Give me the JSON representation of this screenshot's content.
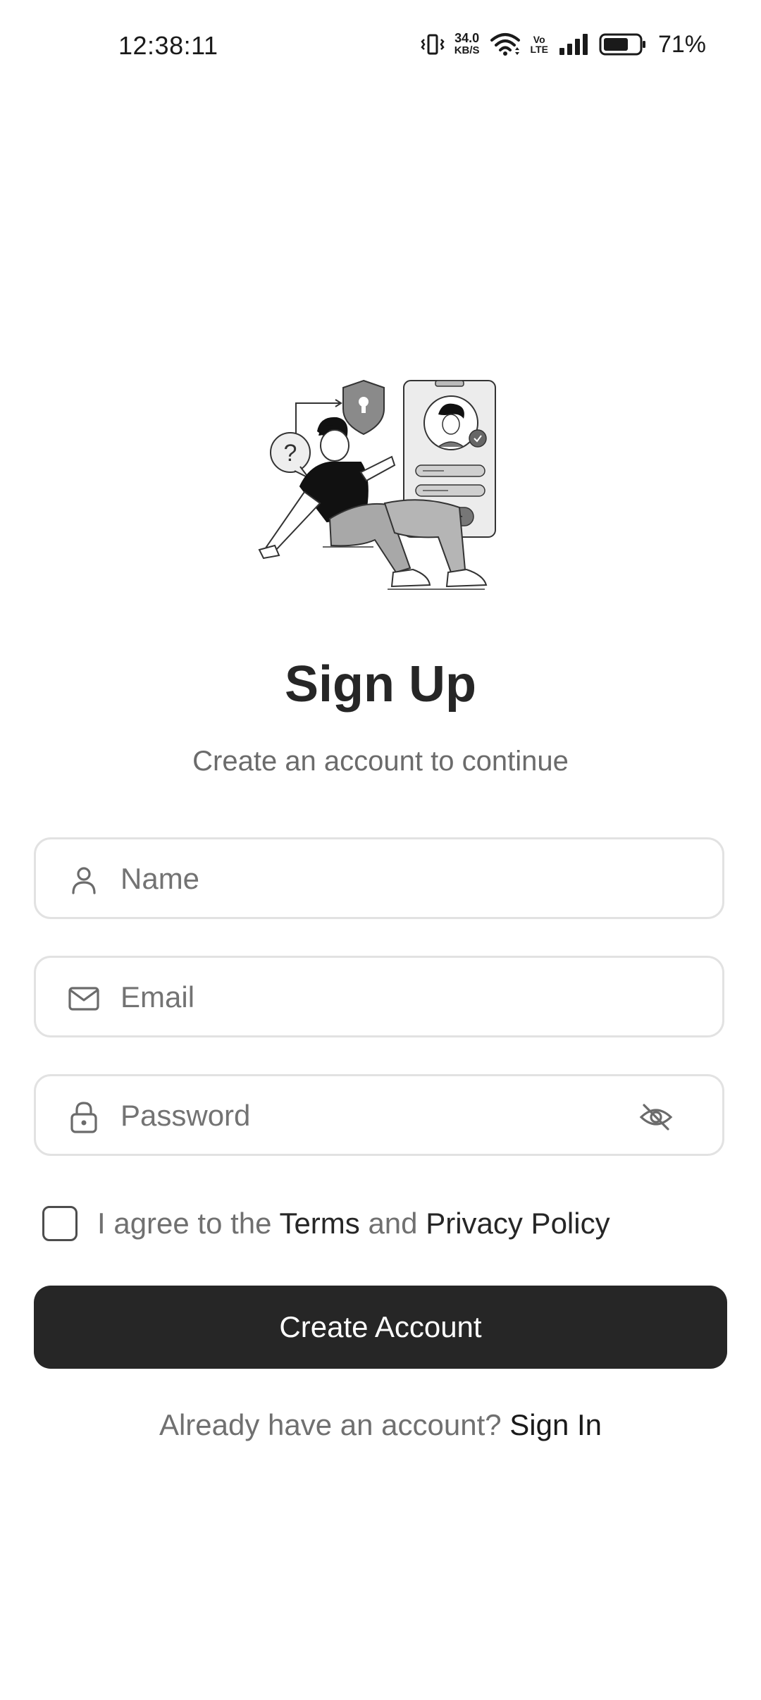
{
  "status_bar": {
    "time": "12:38:11",
    "net_speed_value": "34.0",
    "net_speed_unit": "KB/S",
    "volte_top": "Vo",
    "volte_bottom": "LTE",
    "battery_percent": "71%",
    "battery_level": 0.71
  },
  "header": {
    "title": "Sign Up",
    "subtitle": "Create an account to continue"
  },
  "form": {
    "name_placeholder": "Name",
    "email_placeholder": "Email",
    "password_placeholder": "Password",
    "agree_prefix": "I agree to the",
    "terms_link": "Terms",
    "agree_and": "and",
    "privacy_link": "Privacy Policy",
    "submit_label": "Create Account"
  },
  "footer": {
    "prompt": "Already have an account?",
    "signin_link": "Sign In"
  },
  "colors": {
    "primary": "#262626",
    "muted_text": "#707070",
    "border": "#e2e2e2"
  }
}
